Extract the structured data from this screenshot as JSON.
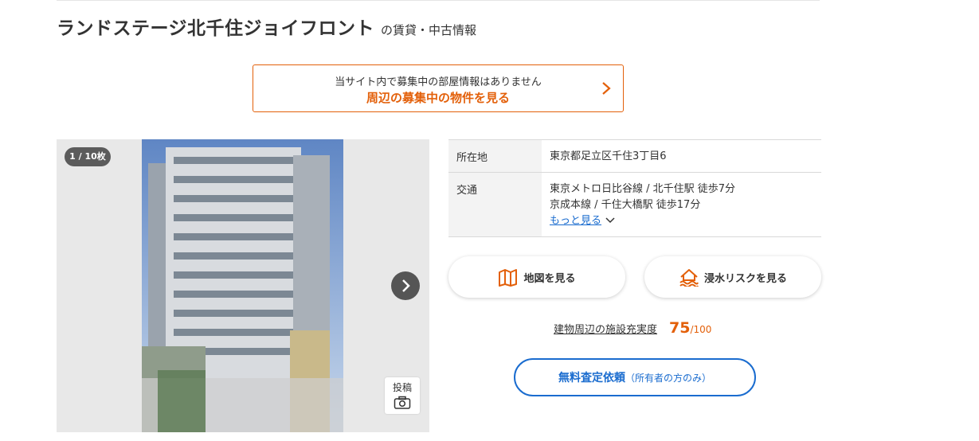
{
  "header": {
    "title": "ランドステージ北千住ジョイフロント",
    "subtitle": "の賃貸・中古情報"
  },
  "notice": {
    "message": "当サイト内で募集中の部屋情報はありません",
    "link_label": "周辺の募集中の物件を見る",
    "icon": "chevron-right-icon"
  },
  "gallery": {
    "counter": "1 / 10枚",
    "post_label": "投稿",
    "icons": [
      "chevron-right-icon",
      "camera-icon"
    ]
  },
  "info": {
    "address_label": "所在地",
    "address_value": "東京都足立区千住3丁目6",
    "transit_label": "交通",
    "transit_lines": [
      "東京メトロ日比谷線 / 北千住駅 徒歩7分",
      "京成本線 / 千住大橋駅 徒歩17分"
    ],
    "more_label": "もっと見る"
  },
  "actions": {
    "map_label": "地図を見る",
    "flood_label": "浸水リスクを見る"
  },
  "score": {
    "label": "建物周辺の施設充実度",
    "value": "75",
    "max": "/100"
  },
  "assessment": {
    "label": "無料査定依頼",
    "note": "（所有者の方のみ）"
  },
  "colors": {
    "accent_orange": "#e3600a",
    "link_blue": "#1a6ccf"
  }
}
